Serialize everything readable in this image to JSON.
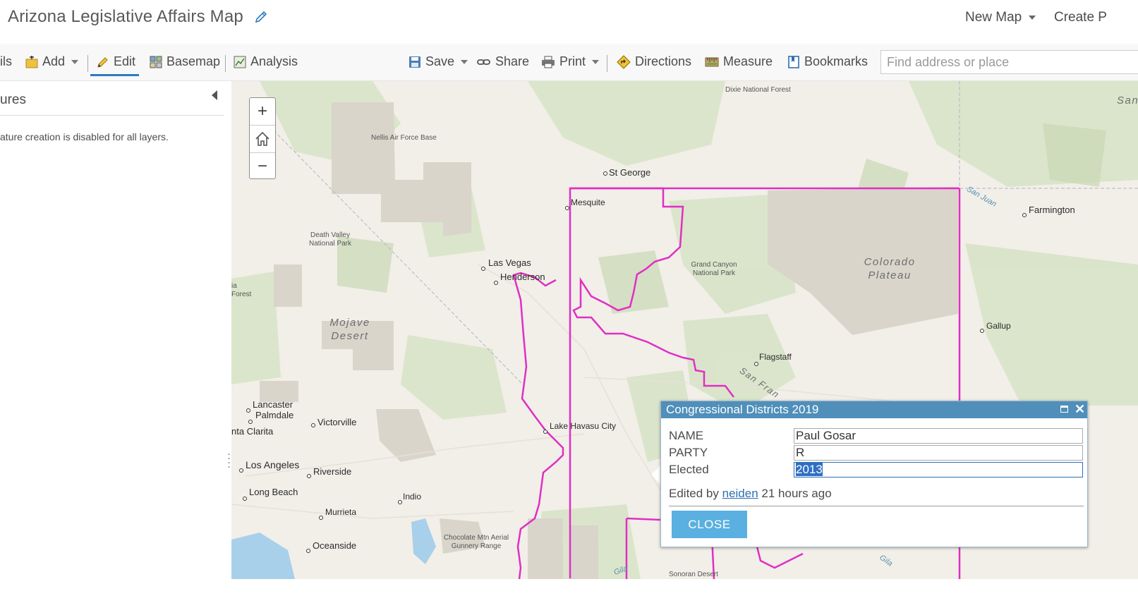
{
  "header": {
    "title": "Arizona Legislative Affairs Map",
    "new_map": "New Map",
    "create": "Create P"
  },
  "toolbar": {
    "details": "ils",
    "add": "Add",
    "edit": "Edit",
    "basemap": "Basemap",
    "analysis": "Analysis",
    "save": "Save",
    "share": "Share",
    "print": "Print",
    "directions": "Directions",
    "measure": "Measure",
    "bookmarks": "Bookmarks",
    "search_placeholder": "Find address or place"
  },
  "left_panel": {
    "title": "ures",
    "message": "ature creation is disabled for all layers."
  },
  "map": {
    "zoom_in": "+",
    "zoom_out": "−",
    "labels": {
      "dixie": "Dixie National Forest",
      "nellis": "Nellis Air Force Base",
      "st_george": "St George",
      "san_juan": "San Juan",
      "farmington": "Farmington",
      "san_mo": "San Mo",
      "mesquite": "Mesquite",
      "death_valley": "Death Valley National Park",
      "las_vegas": "Las Vegas",
      "henderson": "Henderson",
      "grand_canyon": "Grand Canyon National Park",
      "colorado_plateau": "Colorado Plateau",
      "ia_forest": "ia Forest",
      "mojave": "Mojave Desert",
      "gallup": "Gallup",
      "flagstaff": "Flagstaff",
      "san_fran": "San Fran",
      "lancaster": "Lancaster",
      "palmdale": "Palmdale",
      "victorville": "Victorville",
      "santa_clarita": "nta Clarita",
      "lake_havasu": "Lake Havasu City",
      "los_angeles": "Los Angeles",
      "riverside": "Riverside",
      "long_beach": "Long Beach",
      "indio": "Indio",
      "murrieta": "Murrieta",
      "oceanside": "Oceanside",
      "chocolate": "Chocolate Mtn Aerial Gunnery Range",
      "gila1": "Gila",
      "gila2": "Gila",
      "sonoran": "Sonoran Desert"
    }
  },
  "popup": {
    "title": "Congressional Districts 2019",
    "fields": [
      {
        "label": "NAME",
        "value": "Paul Gosar"
      },
      {
        "label": "PARTY",
        "value": "R"
      },
      {
        "label": "Elected",
        "value": "2013"
      }
    ],
    "edited_prefix": "Edited by",
    "edited_user": "neiden",
    "edited_suffix": "21 hours ago",
    "close_label": "CLOSE"
  },
  "colors": {
    "district_line": "#e02fc4",
    "popup_header": "#4f8fba",
    "close_button": "#5ab0e0",
    "edit_underline": "#2d7bbf"
  }
}
